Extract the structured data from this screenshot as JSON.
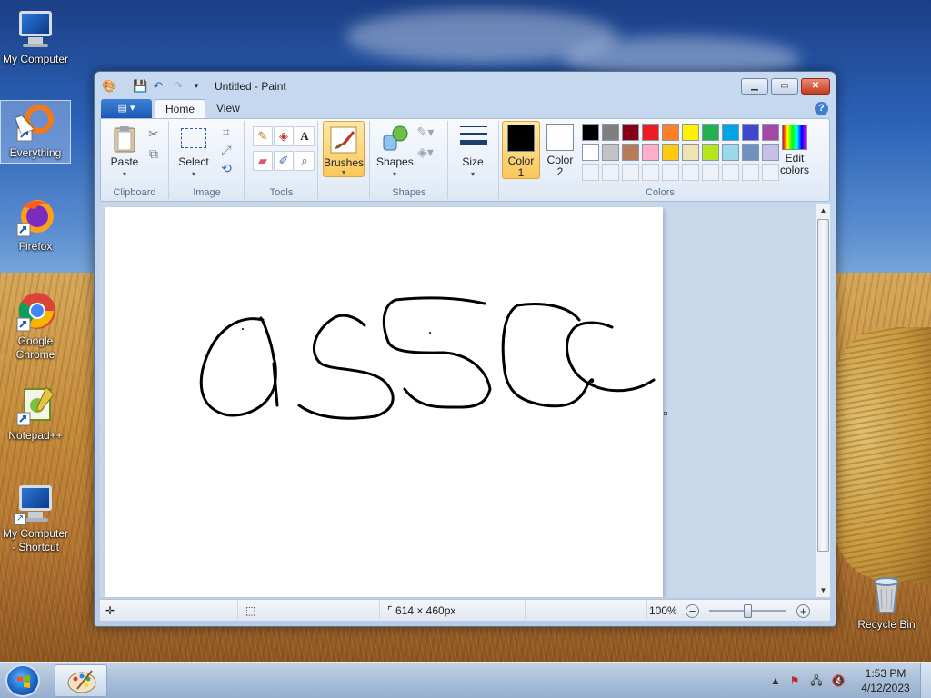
{
  "desktop": {
    "icons": [
      {
        "label": "My Computer",
        "icon": "computer-icon"
      },
      {
        "label": "Everything",
        "icon": "everything-search-icon"
      },
      {
        "label": "Firefox",
        "icon": "firefox-icon"
      },
      {
        "label": "Google Chrome",
        "icon": "chrome-icon"
      },
      {
        "label": "Notepad++",
        "icon": "notepadpp-icon"
      },
      {
        "label": "My Computer - Shortcut",
        "icon": "computer-shortcut-icon"
      },
      {
        "label": "Recycle Bin",
        "icon": "recycle-bin-icon"
      }
    ]
  },
  "window": {
    "title": "Untitled - Paint",
    "controls": {
      "minimize": "▁",
      "maximize": "▭",
      "close": "✕"
    }
  },
  "ribbon": {
    "file_tab": "▤ ▾",
    "tabs": [
      "Home",
      "View"
    ],
    "active_tab": "Home",
    "help": "?",
    "groups": {
      "clipboard": {
        "label": "Clipboard",
        "paste": "Paste"
      },
      "image": {
        "label": "Image",
        "select": "Select"
      },
      "tools": {
        "label": "Tools"
      },
      "brushes": {
        "label": "Brushes"
      },
      "shapes": {
        "label": "Shapes",
        "shapes_btn": "Shapes"
      },
      "size": {
        "label": "Size"
      },
      "colors": {
        "label": "Colors",
        "color1": "Color",
        "color1_num": "1",
        "color2": "Color",
        "color2_num": "2",
        "edit_colors_1": "Edit",
        "edit_colors_2": "colors",
        "color1_value": "#000000",
        "color2_value": "#ffffff",
        "palette_row1": [
          "#000000",
          "#7f7f7f",
          "#880015",
          "#ed1c24",
          "#ff7f27",
          "#fff200",
          "#22b14c",
          "#00a2e8",
          "#3f48cc",
          "#a349a4"
        ],
        "palette_row2": [
          "#ffffff",
          "#c3c3c3",
          "#b97a57",
          "#ffaec9",
          "#ffc90e",
          "#efe4b0",
          "#b5e61d",
          "#99d9ea",
          "#7092be",
          "#c8bfe7"
        ]
      }
    }
  },
  "canvas": {
    "drawing_text": "assc"
  },
  "statusbar": {
    "canvas_size": "614 × 460px",
    "zoom": "100%"
  },
  "taskbar": {
    "time": "1:53 PM",
    "date": "4/12/2023"
  }
}
